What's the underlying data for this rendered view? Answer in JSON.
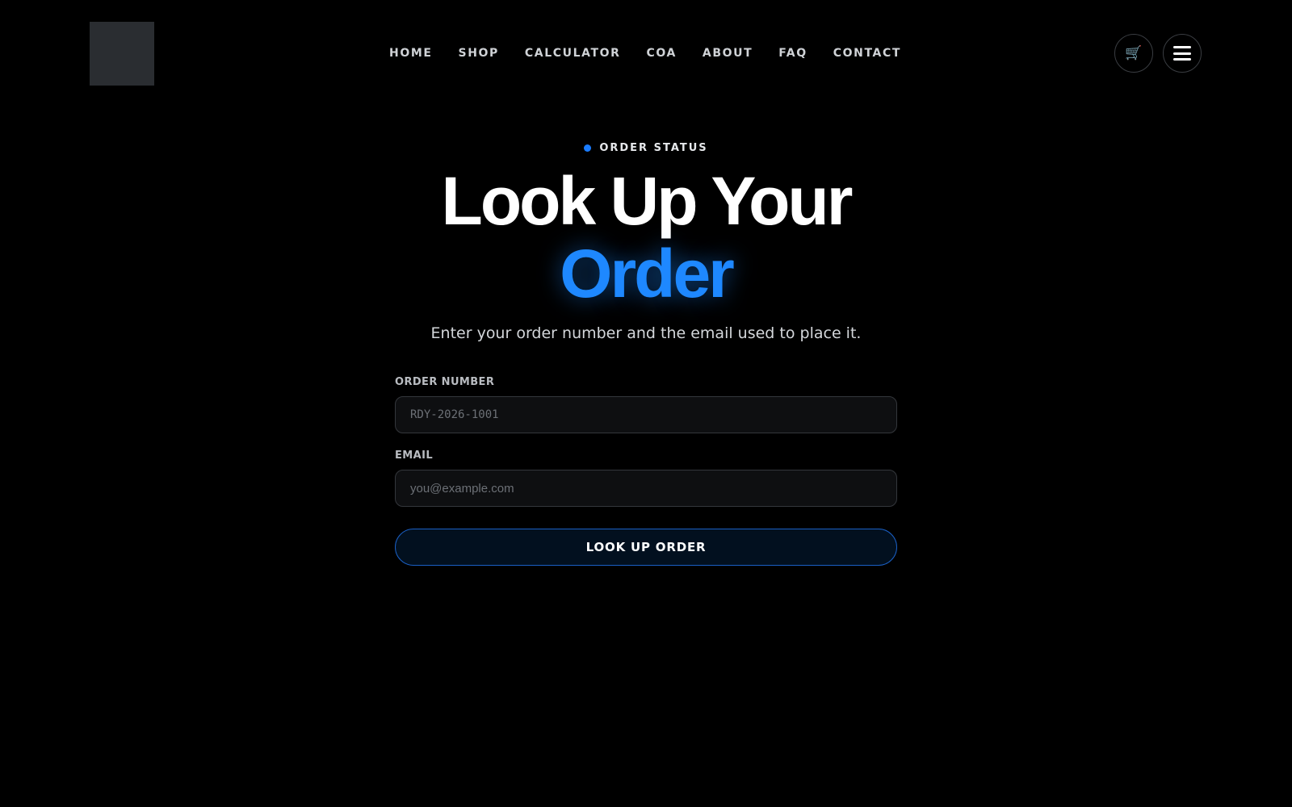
{
  "header": {
    "nav": [
      {
        "label": "HOME"
      },
      {
        "label": "SHOP"
      },
      {
        "label": "CALCULATOR"
      },
      {
        "label": "COA"
      },
      {
        "label": "ABOUT"
      },
      {
        "label": "FAQ"
      },
      {
        "label": "CONTACT"
      }
    ],
    "cart_icon": "cart-icon",
    "menu_icon": "hamburger-menu-icon"
  },
  "hero": {
    "eyebrow": "ORDER STATUS",
    "title_line1": "Look Up Your",
    "title_line2": "Order",
    "subtitle": "Enter your order number and the email used to place it."
  },
  "form": {
    "order_number_label": "ORDER NUMBER",
    "order_number_placeholder": "RDY-2026-1001",
    "email_label": "EMAIL",
    "email_placeholder": "you@example.com",
    "submit_label": "LOOK UP ORDER"
  },
  "colors": {
    "background": "#000000",
    "accent": "#1e88ff",
    "button_border": "#1a5fc4"
  }
}
